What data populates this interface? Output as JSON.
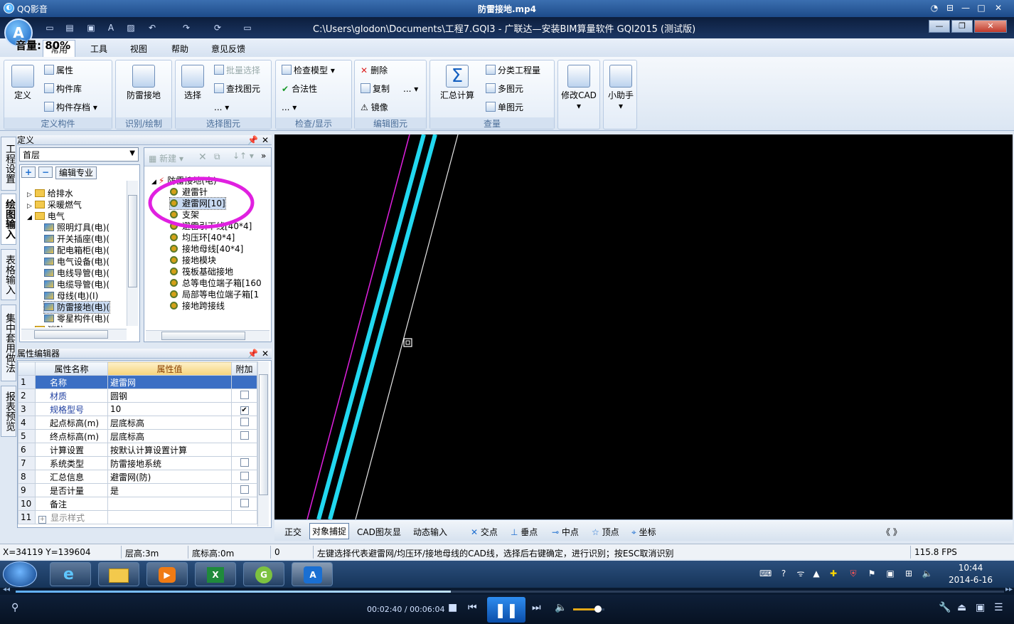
{
  "player": {
    "name": "QQ影音",
    "file": "防雷接地.mp4",
    "volume_overlay": "音量: 80%",
    "time": "00:02:40 / 00:06:04",
    "progress": 0.44,
    "volume_level": 0.8
  },
  "app": {
    "title_path": "C:\\Users\\glodon\\Documents\\工程7.GQI3 - 广联达—安装BIM算量软件 GQI2015 (测试版)",
    "logo_letter": "A"
  },
  "menu": {
    "items": [
      "常用",
      "工具",
      "视图",
      "帮助",
      "意见反馈"
    ],
    "active": "常用"
  },
  "ribbon": {
    "groups": [
      {
        "label": "定义构件",
        "big": "定义",
        "items": [
          "属性",
          "构件库",
          "构件存档"
        ]
      },
      {
        "label": "识别/绘制",
        "big": "防雷接地",
        "items": []
      },
      {
        "label": "选择图元",
        "big": "选择",
        "items": [
          "批量选择",
          "查找图元",
          "..."
        ]
      },
      {
        "label": "检查/显示",
        "big": "",
        "items": [
          "检查模型",
          "合法性",
          "..."
        ]
      },
      {
        "label": "编辑图元",
        "big": "",
        "items": [
          "删除",
          "复制",
          "镜像",
          "..."
        ]
      },
      {
        "label": "查量",
        "big": "汇总计算",
        "items": [
          "分类工程量",
          "多图元",
          "单图元"
        ]
      },
      {
        "label": "",
        "big": "修改CAD",
        "items": []
      },
      {
        "label": "",
        "big": "小助手",
        "items": []
      }
    ]
  },
  "vtabs": [
    "工程设置",
    "绘图输入",
    "表格输入",
    "集中套用做法",
    "报表预览"
  ],
  "define_panel": {
    "title": "定义",
    "floor": "首层",
    "edit_btn": "编辑专业",
    "tree": [
      {
        "label": "给排水",
        "level": 1,
        "type": "folder"
      },
      {
        "label": "采暖燃气",
        "level": 1,
        "type": "folder"
      },
      {
        "label": "电气",
        "level": 1,
        "type": "folder"
      },
      {
        "label": "照明灯具(电)(",
        "level": 2,
        "type": "item"
      },
      {
        "label": "开关插座(电)(",
        "level": 2,
        "type": "item"
      },
      {
        "label": "配电箱柜(电)(",
        "level": 2,
        "type": "item"
      },
      {
        "label": "电气设备(电)(",
        "level": 2,
        "type": "item"
      },
      {
        "label": "电线导管(电)(",
        "level": 2,
        "type": "item"
      },
      {
        "label": "电缆导管(电)(",
        "level": 2,
        "type": "item"
      },
      {
        "label": "母线(电)(I)",
        "level": 2,
        "type": "item"
      },
      {
        "label": "防雷接地(电)(",
        "level": 2,
        "type": "item",
        "selected": true
      },
      {
        "label": "零星构件(电)(",
        "level": 2,
        "type": "item"
      },
      {
        "label": "消防",
        "level": 1,
        "type": "folder"
      }
    ]
  },
  "component_panel": {
    "new_btn": "新建",
    "root": "防雷接地(电)",
    "items": [
      "避雷针",
      "避雷网[10]",
      "支架",
      "避雷引下线[40*4]",
      "均压环[40*4]",
      "接地母线[40*4]",
      "接地模块",
      "筏板基础接地",
      "总等电位端子箱[160",
      "局部等电位端子箱[1",
      "接地跨接线"
    ],
    "selected": "避雷网[10]"
  },
  "property_panel": {
    "title": "属性编辑器",
    "headers": [
      "属性名称",
      "属性值",
      "附加"
    ],
    "rows": [
      {
        "no": "1",
        "name": "名称",
        "value": "避雷网",
        "extra": "",
        "blue": true,
        "selected": true
      },
      {
        "no": "2",
        "name": "材质",
        "value": "圆钢",
        "extra": "box",
        "blue": true
      },
      {
        "no": "3",
        "name": "规格型号",
        "value": "10",
        "extra": "checked",
        "blue": true
      },
      {
        "no": "4",
        "name": "起点标高(m)",
        "value": "层底标高",
        "extra": "box"
      },
      {
        "no": "5",
        "name": "终点标高(m)",
        "value": "层底标高",
        "extra": "box"
      },
      {
        "no": "6",
        "name": "计算设置",
        "value": "按默认计算设置计算",
        "extra": ""
      },
      {
        "no": "7",
        "name": "系统类型",
        "value": "防雷接地系统",
        "extra": "box"
      },
      {
        "no": "8",
        "name": "汇总信息",
        "value": "避雷网(防)",
        "extra": "box"
      },
      {
        "no": "9",
        "name": "是否计量",
        "value": "是",
        "extra": "box"
      },
      {
        "no": "10",
        "name": "备注",
        "value": "",
        "extra": "box"
      },
      {
        "no": "11",
        "name": "显示样式",
        "value": "",
        "extra": "",
        "expand": true
      }
    ]
  },
  "snapbar": {
    "items": [
      "正交",
      "对象捕捉",
      "CAD图灰显",
      "动态输入",
      "交点",
      "垂点",
      "中点",
      "顶点",
      "坐标"
    ],
    "active": "对象捕捉",
    "nav": "《 》"
  },
  "status": {
    "coords": "X=34119 Y=139604",
    "floor_height": "层高:3m",
    "base_height": "底标高:0m",
    "zero": "0",
    "hint": "左键选择代表避雷网/均压环/接地母线的CAD线，选择后右键确定，进行识别；按ESC取消识别",
    "fps": "115.8 FPS"
  },
  "taskbar": {
    "clock_time": "10:44",
    "clock_date": "2014-6-16"
  },
  "colors": {
    "cyan_line": "#22d8f0",
    "magenta": "#e020e0",
    "canvas_bg": "#000000"
  }
}
